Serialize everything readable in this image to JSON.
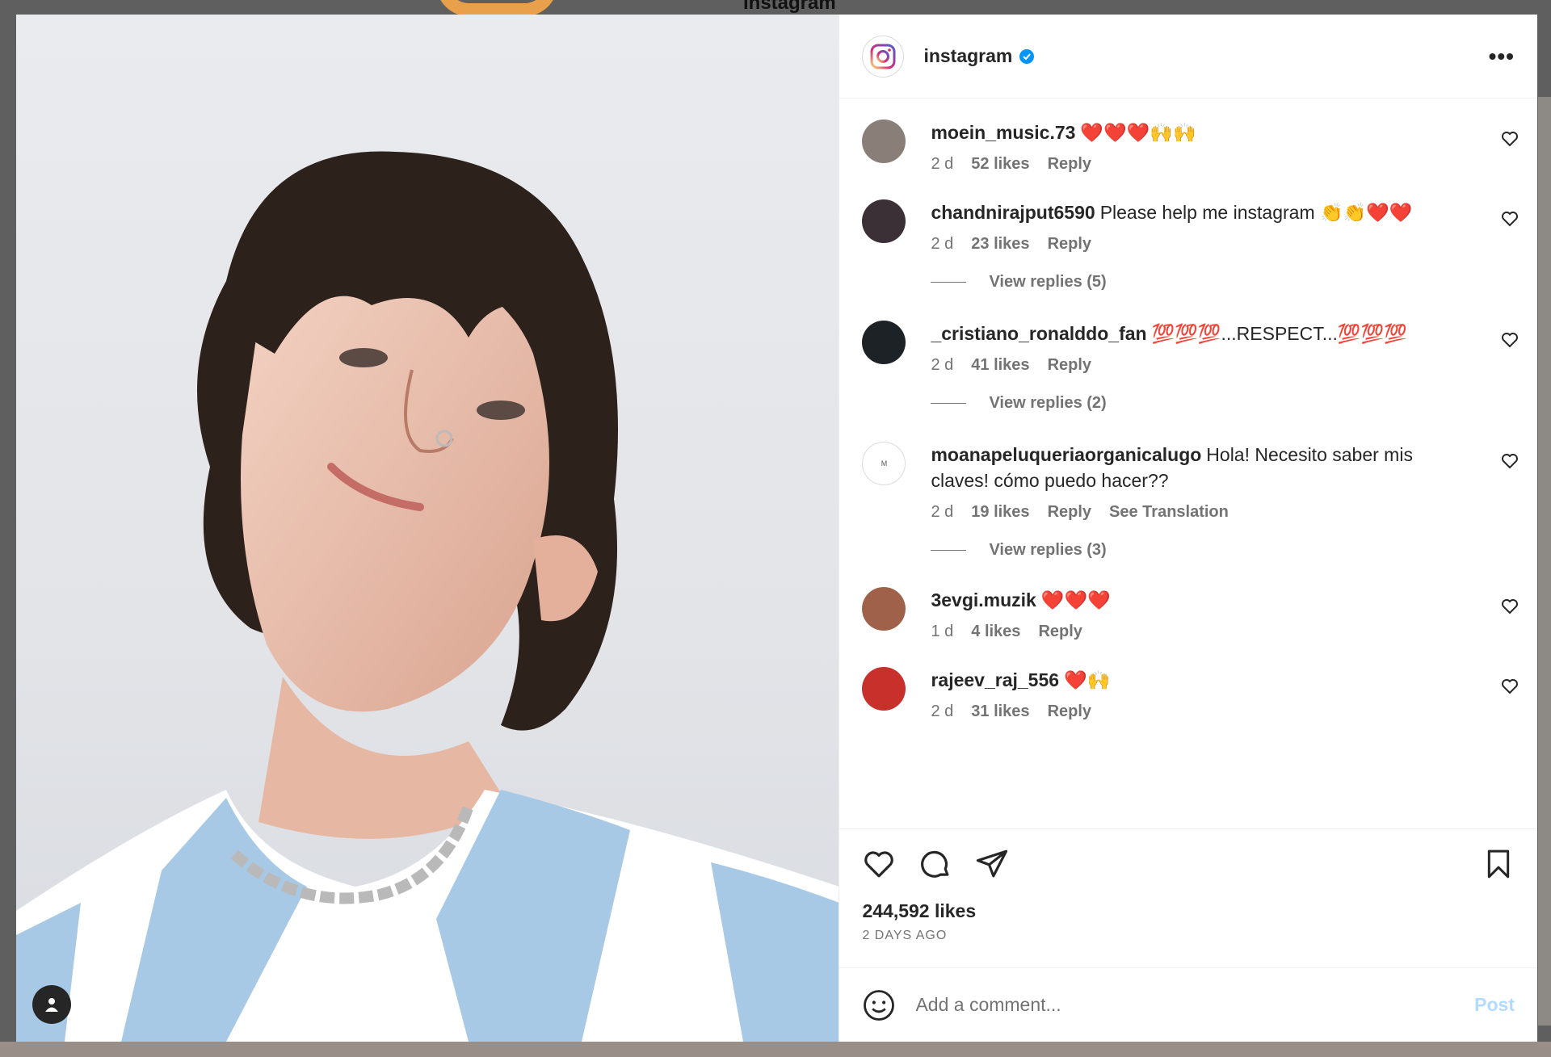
{
  "background": {
    "title": "Instagram"
  },
  "post": {
    "account": "instagram",
    "likes": "244,592 likes",
    "date": "2 DAYS AGO"
  },
  "comments": [
    {
      "user": "moein_music.73",
      "text": "❤️❤️❤️🙌🙌",
      "time": "2 d",
      "likes": "52 likes",
      "reply": "Reply",
      "avatar_color": "#8a7f78"
    },
    {
      "user": "chandnirajput6590",
      "text": "Please help me instagram 👏👏❤️❤️",
      "time": "2 d",
      "likes": "23 likes",
      "reply": "Reply",
      "view_replies": "View replies (5)",
      "avatar_color": "#3a3036"
    },
    {
      "user": "_cristiano_ronalddo_fan",
      "text": "💯💯💯...RESPECT...💯💯💯",
      "time": "2 d",
      "likes": "41 likes",
      "reply": "Reply",
      "view_replies": "View replies (2)",
      "avatar_color": "#1d2226"
    },
    {
      "user": "moanapeluqueriaorganicalugo",
      "text": "Hola! Necesito saber mis claves! cómo puedo hacer??",
      "time": "2 d",
      "likes": "19 likes",
      "reply": "Reply",
      "translate": "See Translation",
      "view_replies": "View replies (3)",
      "avatar_color": "#ffffff"
    },
    {
      "user": "3evgi.muzik",
      "text": "❤️❤️❤️",
      "time": "1 d",
      "likes": "4 likes",
      "reply": "Reply",
      "avatar_color": "#a0614a"
    },
    {
      "user": "rajeev_raj_556",
      "text": "❤️🙌",
      "time": "2 d",
      "likes": "31 likes",
      "reply": "Reply",
      "avatar_color": "#c8302c"
    }
  ],
  "composer": {
    "placeholder": "Add a comment...",
    "post_label": "Post"
  },
  "colors": {
    "accent": "#0095f6",
    "post_disabled": "#b3dbff",
    "verified": "#0095f6"
  }
}
